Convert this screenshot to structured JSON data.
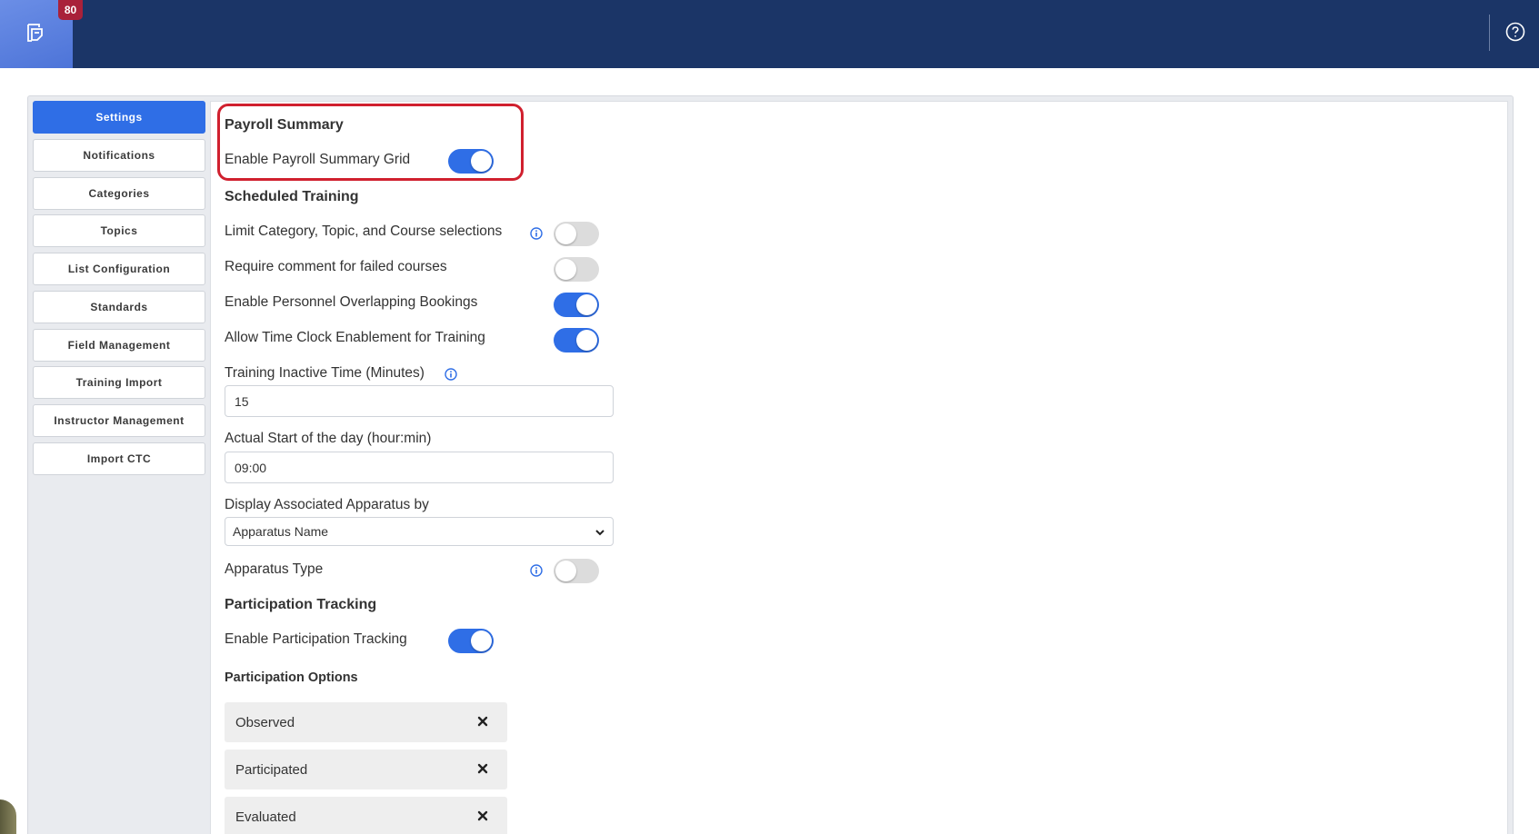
{
  "app": {
    "badge_count": "80",
    "logo_icon": "document-stack-icon",
    "help_icon": "question-circle-icon"
  },
  "colors": {
    "header": "#1b3567",
    "accent": "#2f6ee6",
    "highlight": "#d0202e"
  },
  "sidebar": {
    "items": [
      {
        "label": "Settings",
        "active": true
      },
      {
        "label": "Notifications"
      },
      {
        "label": "Categories"
      },
      {
        "label": "Topics"
      },
      {
        "label": "List Configuration"
      },
      {
        "label": "Standards"
      },
      {
        "label": "Field Management"
      },
      {
        "label": "Training Import"
      },
      {
        "label": "Instructor Management"
      },
      {
        "label": "Import CTC"
      }
    ]
  },
  "payroll": {
    "heading": "Payroll Summary",
    "enable_grid_label": "Enable Payroll Summary Grid",
    "enable_grid_on": true
  },
  "scheduled": {
    "heading": "Scheduled Training",
    "limit_label": "Limit Category, Topic, and Course selections",
    "limit_on": false,
    "require_comment_label": "Require comment for failed courses",
    "require_comment_on": false,
    "overlap_label": "Enable Personnel Overlapping Bookings",
    "overlap_on": true,
    "timeclock_label": "Allow Time Clock Enablement for Training",
    "timeclock_on": true,
    "inactive_label": "Training Inactive Time (Minutes)",
    "inactive_value": "15",
    "start_label": "Actual Start of the day (hour:min)",
    "start_value": "09:00",
    "apparatus_by_label": "Display Associated Apparatus by",
    "apparatus_by_value": "Apparatus Name",
    "apparatus_type_label": "Apparatus Type",
    "apparatus_type_on": false
  },
  "participation": {
    "heading": "Participation Tracking",
    "enable_label": "Enable Participation Tracking",
    "enable_on": true,
    "options_label": "Participation Options",
    "options": [
      "Observed",
      "Participated",
      "Evaluated"
    ]
  }
}
